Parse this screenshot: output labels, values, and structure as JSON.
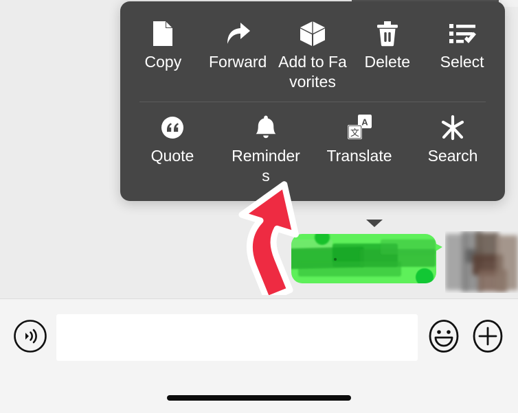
{
  "app": {
    "platform": "mobile-messaging-app",
    "background_color": "#ececec"
  },
  "context_menu": {
    "background_color": "#464646",
    "text_color": "#ffffff",
    "rows": [
      {
        "items": [
          {
            "label": "Copy",
            "icon": "document-page-icon"
          },
          {
            "label": "Forward",
            "icon": "forward-arrow-icon"
          },
          {
            "label": "Add to Favorites",
            "icon": "cube-box-icon"
          },
          {
            "label": "Delete",
            "icon": "trash-can-icon"
          },
          {
            "label": "Select",
            "icon": "list-checkmark-icon"
          }
        ]
      },
      {
        "items": [
          {
            "label": "Quote",
            "icon": "quotation-mark-circle-icon"
          },
          {
            "label": "Reminders",
            "icon": "bell-icon"
          },
          {
            "label": "Translate",
            "icon": "translate-icon"
          },
          {
            "label": "Search",
            "icon": "sparkle-asterisk-icon"
          }
        ]
      }
    ]
  },
  "annotation": {
    "type": "arrow",
    "points_to": "Translate",
    "fill_color": "#ee2b42",
    "outline_color": "#ffffff"
  },
  "message_bubble": {
    "bubble_color": "#5ef05a",
    "redacted": true,
    "content": ""
  },
  "avatar": {
    "redacted": true,
    "description": "blurred-smudged-thumbnail"
  },
  "composer": {
    "input_value": "",
    "input_placeholder": "",
    "voice_icon": "voice-message-icon",
    "emoji_icon": "smiley-face-icon",
    "add_icon": "plus-circle-icon"
  },
  "system": {
    "home_indicator": true
  }
}
